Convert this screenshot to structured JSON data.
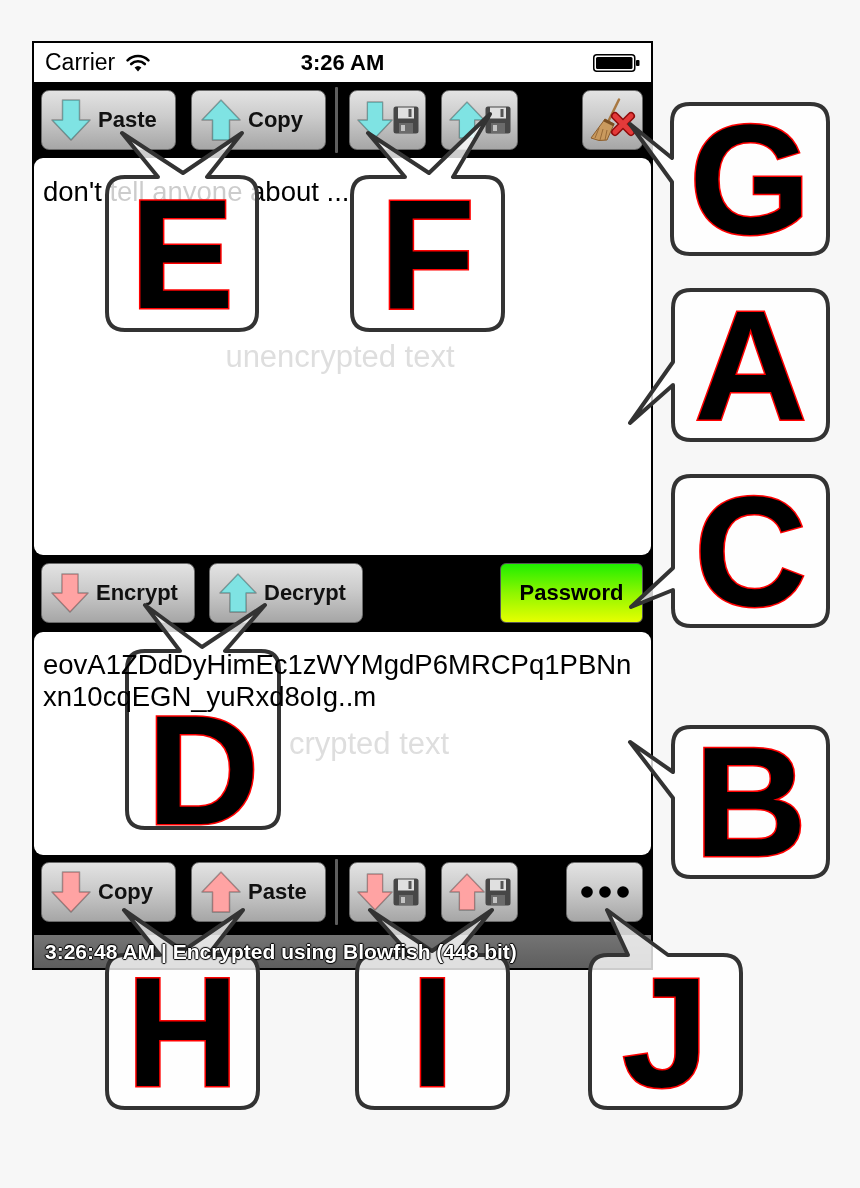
{
  "status_bar": {
    "carrier": "Carrier",
    "time": "3:26 AM"
  },
  "plain_toolbar": {
    "clipboard": [
      {
        "kind": "arrow_down",
        "color": "#7fe3e3",
        "label": "Paste"
      },
      {
        "kind": "arrow_up",
        "color": "#7fe3e3",
        "label": "Copy"
      }
    ],
    "file": [
      {
        "kind": "arrow_down",
        "color": "#7fe3e3"
      },
      {
        "kind": "arrow_up",
        "color": "#7fe3e3"
      }
    ],
    "action": {
      "kind": "clear"
    }
  },
  "plain_text": {
    "value": "don't tell anyone about ...",
    "placeholder": "unencrypted text"
  },
  "cipher_bar": {
    "buttons": [
      {
        "kind": "arrow_down",
        "color": "#ffa3a3",
        "label": "Encrypt"
      },
      {
        "kind": "arrow_up",
        "color": "#7fe3e3",
        "label": "Decrypt"
      }
    ],
    "password_button": {
      "label": "Password"
    }
  },
  "cipher_text": {
    "value": "eovA1ZDdDyHimEc1zWYMgdP6MRCPq1PBNnxn10cqEGN_yuRxd8oIg..m",
    "placeholder": "crypted text"
  },
  "cipher_toolbar": {
    "clipboard": [
      {
        "kind": "arrow_down",
        "color": "#ffa3a3",
        "label": "Copy"
      },
      {
        "kind": "arrow_up",
        "color": "#ffa3a3",
        "label": "Paste"
      }
    ],
    "file": [
      {
        "kind": "arrow_down",
        "color": "#ffa3a3"
      },
      {
        "kind": "arrow_up",
        "color": "#ffa3a3"
      }
    ],
    "action": {
      "kind": "more"
    }
  },
  "status_message": "3:26:48 AM | Encrypted using Blowfish (448 bit)",
  "callouts": [
    {
      "letter": "E"
    },
    {
      "letter": "F"
    },
    {
      "letter": "G"
    },
    {
      "letter": "A"
    },
    {
      "letter": "C"
    },
    {
      "letter": "D"
    },
    {
      "letter": "B"
    },
    {
      "letter": "H"
    },
    {
      "letter": "I"
    },
    {
      "letter": "J"
    }
  ]
}
